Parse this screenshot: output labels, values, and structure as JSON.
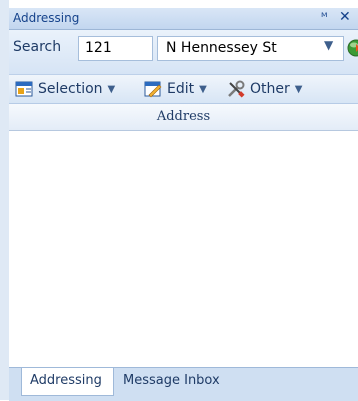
{
  "panel": {
    "title": "Addressing"
  },
  "search": {
    "label": "Search",
    "house_number": "121",
    "street": "N Hennessey St"
  },
  "toolbar": {
    "selection_label": "Selection",
    "edit_label": "Edit",
    "other_label": "Other"
  },
  "list": {
    "column_header": "Address"
  },
  "tabs": [
    {
      "label": "Addressing"
    },
    {
      "label": "Message Inbox"
    }
  ],
  "colors": {
    "title_text": "#15428b",
    "panel_background": "#d6e4f5",
    "tab_strip": "#cfdff2"
  },
  "icons": [
    "pin-icon",
    "close-icon",
    "dropdown-arrow-icon",
    "go-icon",
    "selection-icon",
    "edit-icon",
    "other-tools-icon"
  ]
}
